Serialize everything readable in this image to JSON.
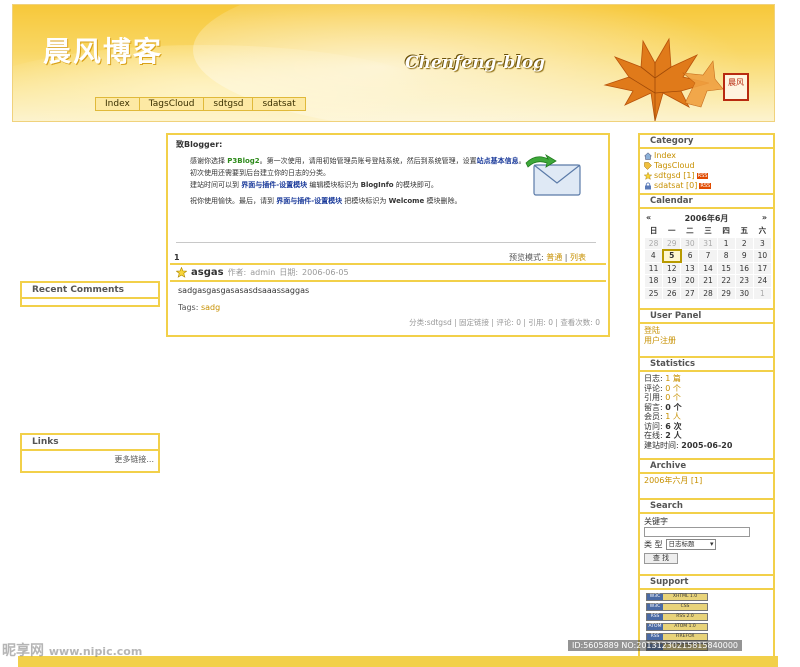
{
  "header": {
    "title_cn": "晨风博客",
    "title_en": "Chenfeng-blog",
    "seal": "晨风",
    "nav": [
      "Index",
      "TagsCloud",
      "sdtgsd",
      "sdatsat"
    ]
  },
  "left": {
    "recent_comments_title": "Recent Comments",
    "links_title": "Links",
    "links_more": "更多链接..."
  },
  "notice": {
    "title": "致Blogger:",
    "p1_a": "感谢你选择",
    "p1_b": "P3Blog2",
    "p1_c": "。第一次使用，请用初始管理员账号登陆系统，然后到系统管理，设置",
    "p1_d": "站点基本信息",
    "p1_e": "。",
    "p2": "初次使用还需要到后台建立你的日志的分类。",
    "p3_a": "建站时间可以到",
    "p3_b": "界面与插件-设置模块",
    "p3_c": "编辑模块标识为",
    "p3_d": "BlogInfo",
    "p3_e": "的模块即可。",
    "p4_a": "祝你使用愉快。最后，请到",
    "p4_b": "界面与插件-设置模块",
    "p4_c": "把模块标识为",
    "p4_d": "Welcome",
    "p4_e": "模块删除。"
  },
  "pager": {
    "page": "1",
    "view_label": "预览模式:",
    "normal": "普通",
    "list": "列表"
  },
  "post": {
    "title": "asgas",
    "author_label": "作者:",
    "author": "admin",
    "date_label": "日期:",
    "date": "2006-06-05",
    "body": "sadgasgasgasasasdsaaassaggas",
    "tags_label": "Tags:",
    "tag": "sadg",
    "category_label": "分类:",
    "category": "sdtgsd",
    "permalink": "固定链接",
    "comments": "评论: 0",
    "trackbacks": "引用: 0",
    "views": "查看次数: 0"
  },
  "sidebar": {
    "category_title": "Category",
    "categories": [
      {
        "label": "Index",
        "icon": "home-icon"
      },
      {
        "label": "TagsCloud",
        "icon": "tag-icon"
      },
      {
        "label": "sdtgsd [1]",
        "icon": "star-icon",
        "badge": "RSS"
      },
      {
        "label": "sdatsat [0]",
        "icon": "lock-icon",
        "badge": "RSS"
      }
    ],
    "calendar_title": "Calendar",
    "calendar_month": "2006年6月",
    "calendar_prev": "«",
    "calendar_next": "»",
    "weekdays": [
      "日",
      "一",
      "二",
      "三",
      "四",
      "五",
      "六"
    ],
    "calendar_rows": [
      [
        "28",
        "29",
        "30",
        "31",
        "1",
        "2",
        "3"
      ],
      [
        "4",
        "5",
        "6",
        "7",
        "8",
        "9",
        "10"
      ],
      [
        "11",
        "12",
        "13",
        "14",
        "15",
        "16",
        "17"
      ],
      [
        "18",
        "19",
        "20",
        "21",
        "22",
        "23",
        "24"
      ],
      [
        "25",
        "26",
        "27",
        "28",
        "29",
        "30",
        "1"
      ]
    ],
    "user_panel_title": "User Panel",
    "user_links": [
      "登陆",
      "用户注册"
    ],
    "statistics_title": "Statistics",
    "stats": [
      {
        "label": "日志:",
        "value": "1 篇"
      },
      {
        "label": "评论:",
        "value": "0 个"
      },
      {
        "label": "引用:",
        "value": "0 个"
      },
      {
        "label": "留言:",
        "value": "0 个"
      },
      {
        "label": "会员:",
        "value": "1 人"
      },
      {
        "label": "访问:",
        "value": "6 次"
      },
      {
        "label": "在线:",
        "value": "2 人"
      },
      {
        "label": "建站时间:",
        "value": "2005-06-20"
      }
    ],
    "archive_title": "Archive",
    "archive_item": "2006年六月 [1]",
    "search_title": "Search",
    "keyword_label": "关键字",
    "type_label": "类 型",
    "type_selected": "日志标题",
    "search_button": "查 找",
    "support_title": "Support",
    "badges": [
      {
        "l": "W3C",
        "r": "XHTML 1.0"
      },
      {
        "l": "W3C",
        "r": "CSS"
      },
      {
        "l": "RSS",
        "r": "RSS 2.0"
      },
      {
        "l": "ATOM",
        "r": "ATOM 1.0"
      },
      {
        "l": "RSS",
        "r": "FIREFOX"
      },
      {
        "l": "P3",
        "r": "POWERED"
      }
    ]
  },
  "watermark": {
    "left": "昵享网",
    "left_url": "www.nipic.com",
    "right": "ID:5605889 NO:20131230215815840000"
  }
}
